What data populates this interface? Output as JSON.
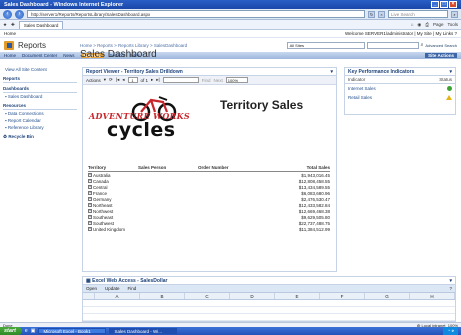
{
  "window": {
    "title": "Sales Dashboard - Windows Internet Explorer"
  },
  "ie": {
    "url": "http://server1/Reports/ReportsLibrary/SalesDashboard.aspx",
    "search_placeholder": "Live Search",
    "tab_label": "Sales Dashboard",
    "page_menu": "Page",
    "tools_menu": "Tools"
  },
  "sharepoint": {
    "home_link": "Home",
    "welcome": "Welcome SERVER1\\administrator",
    "my_site": "My Site",
    "my_links": "My Links",
    "site_name": "Reports",
    "search_scope": "All Sites",
    "advanced_search": "Advanced Search",
    "nav": [
      "Home",
      "Document Center",
      "News",
      "Reports",
      "Search",
      "Sites"
    ],
    "active_nav": "Reports",
    "site_actions": "Site Actions",
    "breadcrumb": "Home > Reports > Reports Library > SalesDashboard",
    "page_title": "Sales Dashboard",
    "quick_launch": {
      "view_all": "View All Site Content",
      "sections": [
        {
          "heading": "Reports",
          "items": []
        },
        {
          "heading": "Dashboards",
          "items": [
            "Sales Dashboard"
          ]
        },
        {
          "heading": "Resources",
          "items": [
            "Data Connections",
            "Report Calendar",
            "Reference Library"
          ]
        }
      ],
      "recycle_bin": "Recycle Bin"
    }
  },
  "report_viewer": {
    "webpart_title": "Report Viewer - Territory Sales Drilldown",
    "actions": "Actions",
    "page_current": "1",
    "page_total": "of 1",
    "find": "Find",
    "next": "Next",
    "zoom": "100%",
    "logo_line1": "ADVENTURE WORKS",
    "logo_line2": "cycles",
    "report_title": "Territory Sales",
    "columns": [
      "Territory",
      "Sales Person",
      "Order Number",
      "Total Sales"
    ],
    "rows": [
      {
        "territory": "Australia",
        "total": "$1,943,016.45"
      },
      {
        "territory": "Canada",
        "total": "$12,808,458.55"
      },
      {
        "territory": "Central",
        "total": "$13,434,589.55"
      },
      {
        "territory": "France",
        "total": "$6,083,680.96"
      },
      {
        "territory": "Germany",
        "total": "$2,476,530.47"
      },
      {
        "territory": "Northeast",
        "total": "$12,433,582.84"
      },
      {
        "territory": "Northwest",
        "total": "$12,669,468.38"
      },
      {
        "territory": "Southeast",
        "total": "$9,629,505.80"
      },
      {
        "territory": "Southwest",
        "total": "$22,737,488.75"
      },
      {
        "territory": "United Kingdom",
        "total": "$11,384,512.99"
      }
    ]
  },
  "kpi": {
    "title": "Key Performance Indicators",
    "col_indicator": "Indicator",
    "col_status": "Status",
    "items": [
      {
        "name": "Internet Sales",
        "status": "good",
        "color": "#3ca332"
      },
      {
        "name": "Retail Sales",
        "status": "warning",
        "color": "#e7b417"
      }
    ]
  },
  "excel": {
    "title": "Excel Web Access - SalesDollar",
    "open_menu": "Open",
    "update_menu": "Update",
    "find": "Find",
    "columns": [
      "A",
      "B",
      "C",
      "D",
      "E",
      "F",
      "G",
      "H"
    ]
  },
  "status_bar": {
    "left": "Done",
    "zone": "Local intranet",
    "zoom": "100%"
  },
  "taskbar": {
    "start": "start",
    "tasks": [
      "Microsoft Excel - Book1",
      "Sales Dashboard - Wi..."
    ]
  }
}
